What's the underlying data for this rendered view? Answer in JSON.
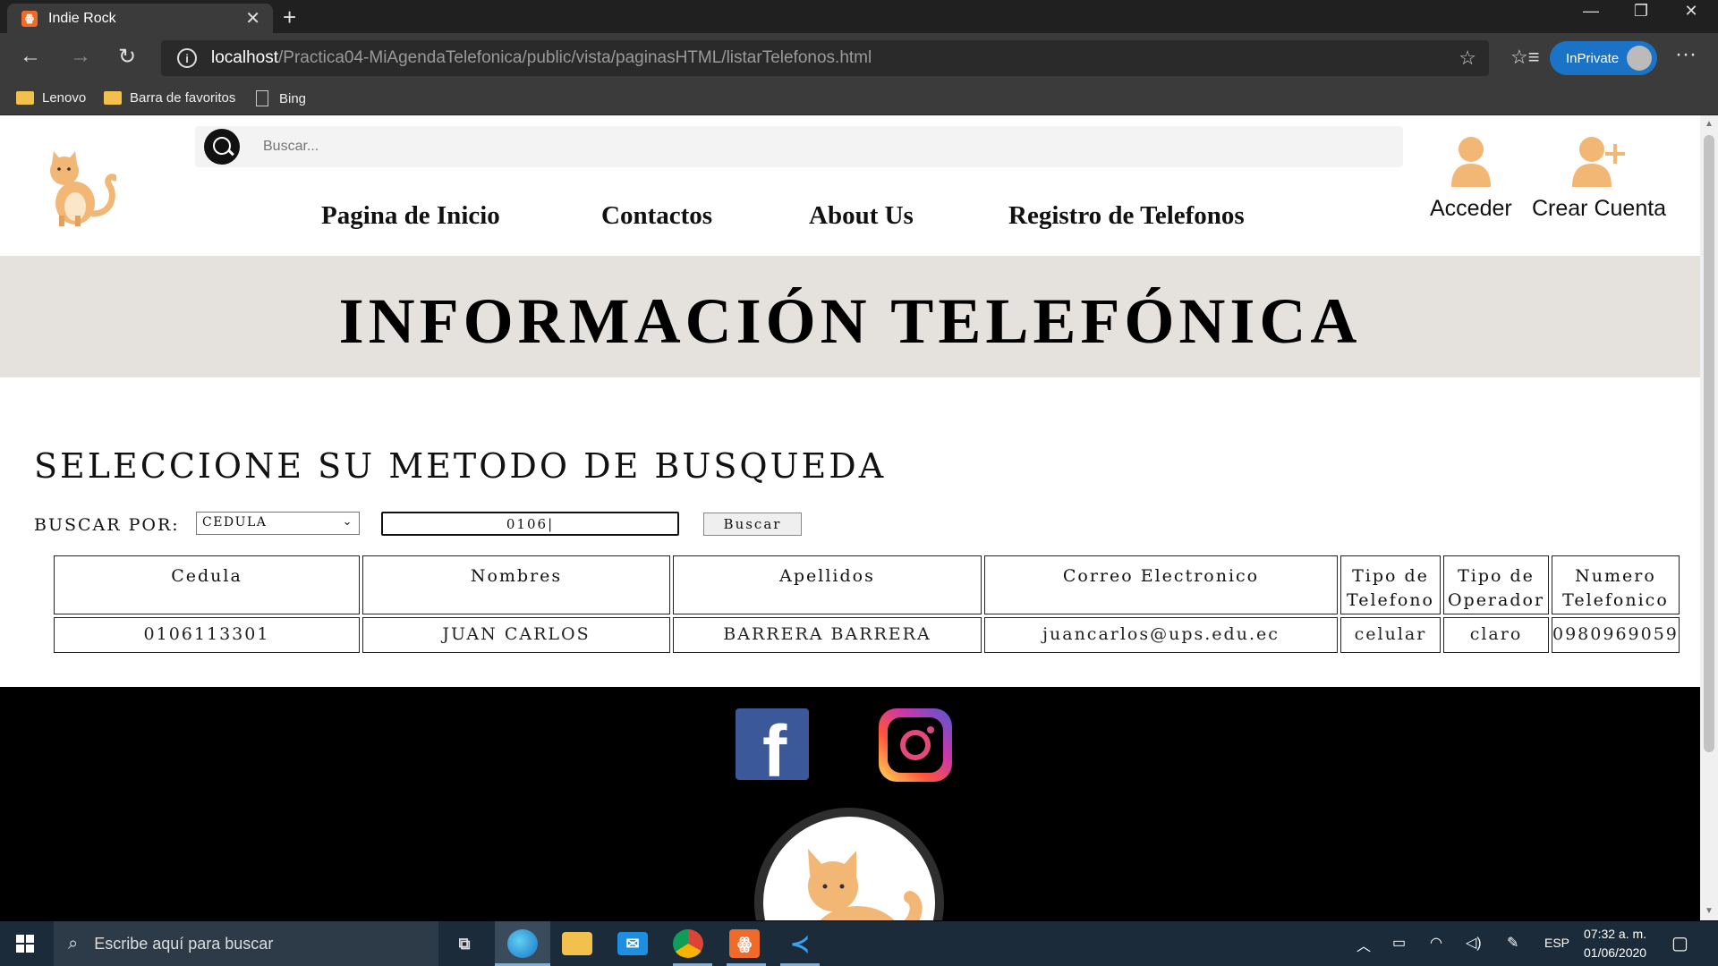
{
  "browser": {
    "tab_title": "Indie Rock",
    "tab_favicon": "XAMPP",
    "url_host": "localhost",
    "url_path": "/Practica04-MiAgendaTelefonica/public/vista/paginasHTML/listarTelefonos.html",
    "inprivate_label": "InPrivate",
    "favorites": [
      {
        "label": "Lenovo",
        "icon": "folder-icon"
      },
      {
        "label": "Barra de favoritos",
        "icon": "folder-icon"
      },
      {
        "label": "Bing",
        "icon": "page-icon"
      }
    ]
  },
  "site": {
    "search_placeholder": "Buscar...",
    "nav": [
      "Pagina de Inicio",
      "Contactos",
      "About Us",
      "Registro de Telefonos"
    ],
    "login_label": "Acceder",
    "signup_label": "Crear Cuenta",
    "hero_title": "INFORMACIÓN TELEFÓNICA",
    "section_title": "SELECCIONE SU METODO DE BUSQUEDA",
    "buscar_label": "BUSCAR POR:",
    "select_value": "CEDULA",
    "input_value": "0106",
    "button_label": "Buscar",
    "accent_color": "#f2b675"
  },
  "table": {
    "headers": [
      "Cedula",
      "Nombres",
      "Apellidos",
      "Correo Electronico",
      "Tipo de Telefono",
      "Tipo de Operador",
      "Numero Telefonico"
    ],
    "rows": [
      [
        "0106113301",
        "JUAN CARLOS",
        "BARRERA BARRERA",
        "juancarlos@ups.edu.ec",
        "celular",
        "claro",
        "0980969059"
      ]
    ]
  },
  "taskbar": {
    "search_placeholder": "Escribe aquí para buscar",
    "language": "ESP",
    "time": "07:32 a. m.",
    "date": "01/06/2020"
  }
}
